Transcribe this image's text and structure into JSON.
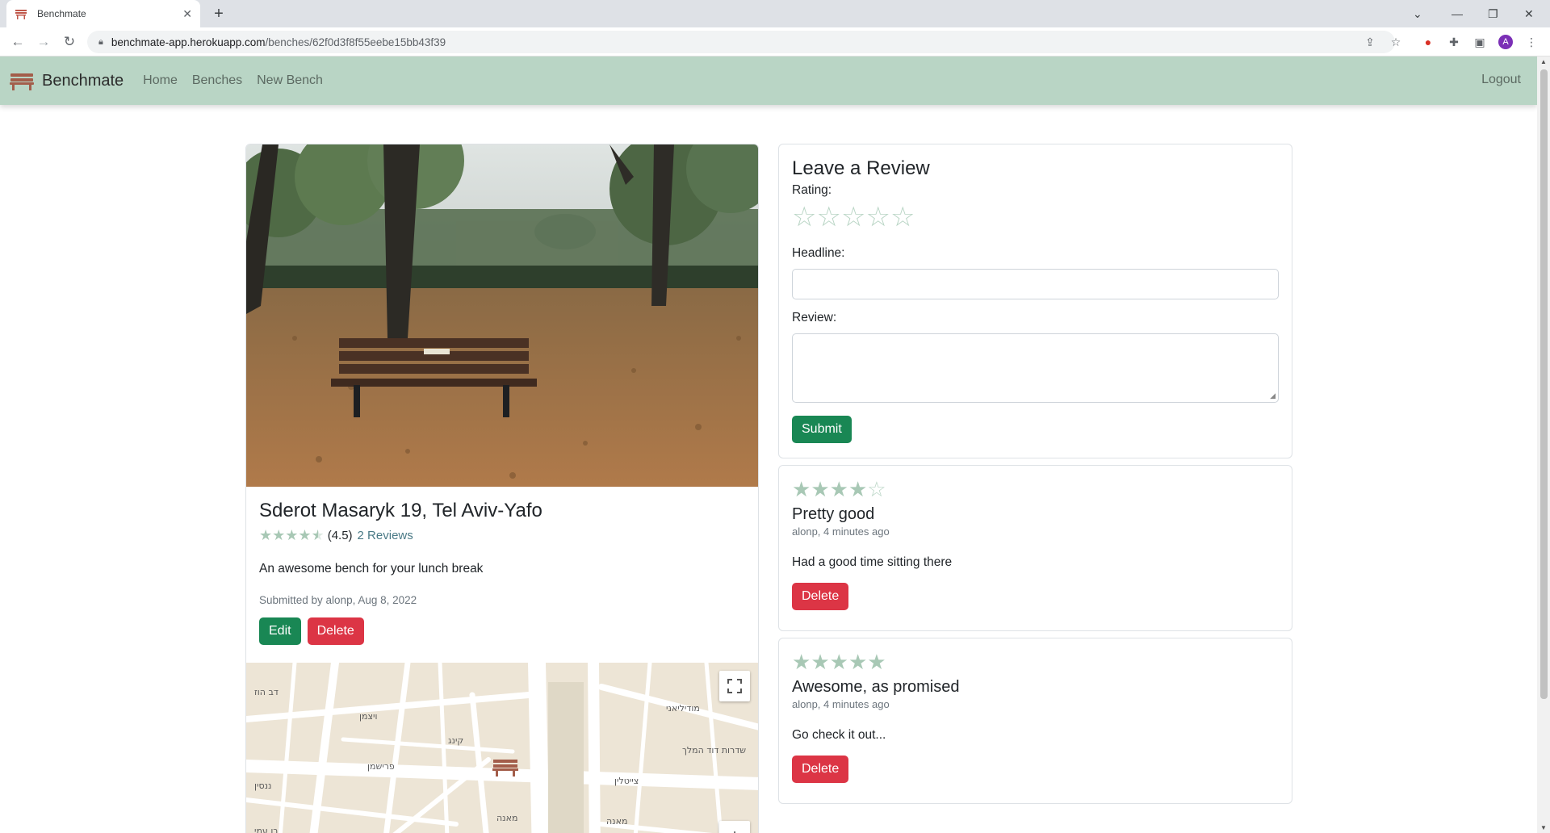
{
  "browser": {
    "tab_title": "Benchmate",
    "tab_close": "✕",
    "new_tab": "+",
    "url_host": "benchmate-app.herokuapp.com",
    "url_path": "/benches/62f0d3f8f55eebe15bb43f39",
    "profile_initial": "A"
  },
  "navbar": {
    "brand": "Benchmate",
    "links": [
      "Home",
      "Benches",
      "New Bench"
    ],
    "logout": "Logout"
  },
  "bench": {
    "title": "Sderot Masaryk 19, Tel Aviv-Yafo",
    "rating_value": 4.5,
    "rating_text": "(4.5)",
    "reviews_link": "2 Reviews",
    "description": "An awesome bench for your lunch break",
    "submitted": "Submitted by alonp, Aug 8, 2022",
    "edit_label": "Edit",
    "delete_label": "Delete"
  },
  "map": {
    "fullscreen_icon": "fullscreen-icon",
    "zoom_in": "+",
    "street_labels": [
      "פרישמן",
      "שדרות דוד המלך",
      "צייטלין",
      "מודיליאני",
      "מאנה",
      "מאנה",
      "בן עמי",
      "ננסין",
      "קינג",
      "ויצמן",
      "דב הוז"
    ]
  },
  "review_form": {
    "heading": "Leave a Review",
    "rating_label": "Rating:",
    "headline_label": "Headline:",
    "headline_value": "",
    "review_label": "Review:",
    "review_value": "",
    "submit_label": "Submit"
  },
  "reviews": [
    {
      "rating": 4,
      "headline": "Pretty good",
      "byline": "alonp, 4 minutes ago",
      "body": "Had a good time sitting there",
      "delete_label": "Delete"
    },
    {
      "rating": 5,
      "headline": "Awesome, as promised",
      "byline": "alonp, 4 minutes ago",
      "body": "Go check it out...",
      "delete_label": "Delete"
    }
  ],
  "colors": {
    "navbar_bg": "#b9d5c5",
    "success": "#198754",
    "danger": "#dc3545",
    "star": "#a8c8b5"
  }
}
